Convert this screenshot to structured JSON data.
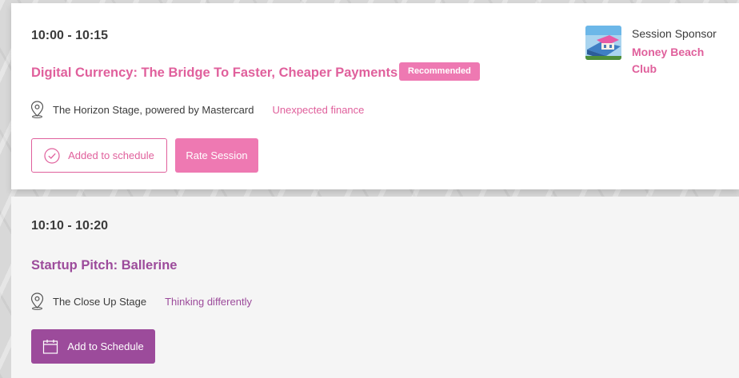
{
  "sessions": [
    {
      "time": "10:00 - 10:15",
      "title": "Digital Currency: The Bridge To Faster, Cheaper Payments",
      "badge": "Recommended",
      "location": "The Horizon Stage, powered by Mastercard",
      "track": "Unexpected finance",
      "added_label": "Added to schedule",
      "rate_label": "Rate Session",
      "sponsor": {
        "label": "Session Sponsor",
        "name": "Money Beach Club"
      }
    },
    {
      "time": "10:10 - 10:20",
      "title": "Startup Pitch: Ballerine",
      "location": "The Close Up Stage",
      "track": "Thinking differently",
      "add_label": "Add to Schedule"
    }
  ],
  "colors": {
    "pink": "#e0609c",
    "pink_fill": "#ee79b2",
    "purple": "#9c4b9b",
    "text": "#3b3b3b"
  },
  "icons": {
    "location": "location-pin-icon",
    "added": "check-circle-icon",
    "calendar": "calendar-icon"
  }
}
